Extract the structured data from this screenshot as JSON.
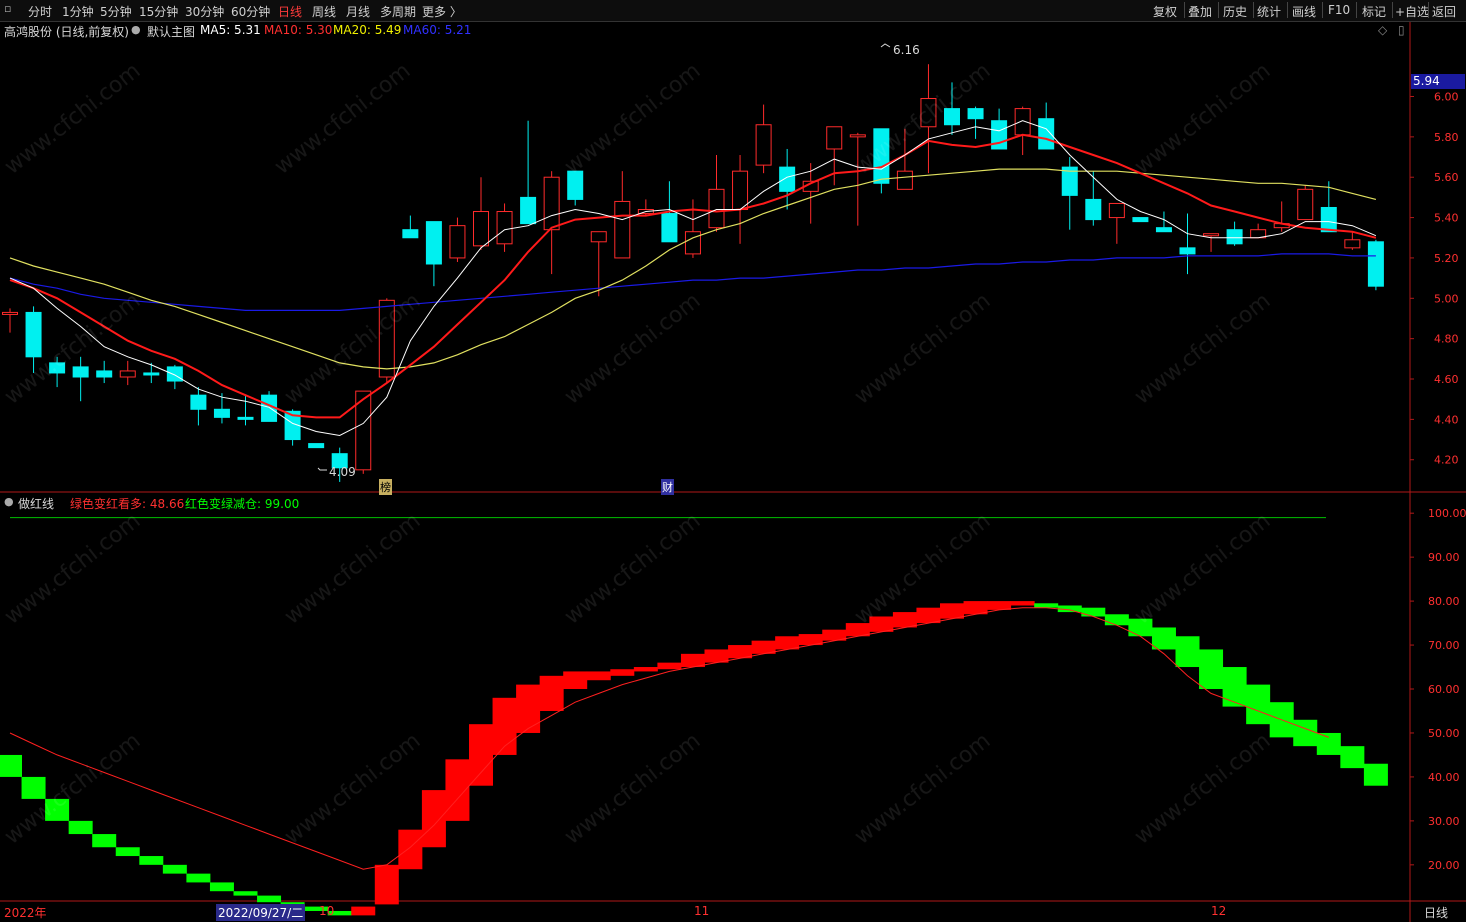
{
  "toolbar": {
    "left_items": [
      "分时",
      "1分钟",
      "5分钟",
      "15分钟",
      "30分钟",
      "60分钟",
      "日线",
      "周线",
      "月线",
      "多周期",
      "更多 〉"
    ],
    "active_item": "日线",
    "right_items": [
      "复权",
      "叠加",
      "历史",
      "统计",
      "画线",
      "F10",
      "标记",
      "+自选",
      "返回"
    ]
  },
  "main_header": {
    "stock": "高鸿股份 (日线,前复权)",
    "chart_name": "默认主图",
    "ma5": "MA5: 5.31",
    "ma10": "MA10: 5.30",
    "ma20": "MA20: 5.49",
    "ma60": "MA60: 5.21"
  },
  "sub_header": {
    "name": "做红线",
    "t1": "绿色变红看多: 48.66",
    "t2": "红色变绿减仓: 99.00"
  },
  "price_tag": "5.94",
  "annotations": {
    "high": "6.16",
    "low": "4.09",
    "mark1": "榜",
    "mark2": "财"
  },
  "xaxis": {
    "year": "2022年",
    "cursor_date": "2022/09/27/二",
    "m10": "10",
    "m11": "11",
    "m12": "12",
    "period": "日线"
  },
  "watermark": "www.cfchi.com",
  "colors": {
    "up": "#ff2b2b",
    "down": "#00f0f0",
    "ma5": "#ffffff",
    "ma10": "#ff1a1a",
    "ma20": "#e0e060",
    "ma60": "#1a1ae6",
    "bull": "#ff0000",
    "bear": "#00ff00"
  },
  "chart_data": [
    {
      "type": "candlestick",
      "title": "高鸿股份 (日线,前复权)",
      "y_ticks": [
        4.2,
        4.4,
        4.6,
        4.8,
        5.0,
        5.2,
        5.4,
        5.6,
        5.8,
        6.0
      ],
      "ylim": [
        4.05,
        6.28
      ],
      "candles": [
        [
          4.92,
          4.95,
          4.83,
          4.93
        ],
        [
          4.93,
          4.96,
          4.63,
          4.71
        ],
        [
          4.68,
          4.71,
          4.56,
          4.63
        ],
        [
          4.66,
          4.71,
          4.49,
          4.61
        ],
        [
          4.64,
          4.69,
          4.58,
          4.61
        ],
        [
          4.61,
          4.69,
          4.57,
          4.64
        ],
        [
          4.63,
          4.68,
          4.58,
          4.62
        ],
        [
          4.66,
          4.67,
          4.55,
          4.59
        ],
        [
          4.52,
          4.56,
          4.37,
          4.45
        ],
        [
          4.45,
          4.53,
          4.38,
          4.41
        ],
        [
          4.41,
          4.52,
          4.37,
          4.4
        ],
        [
          4.52,
          4.54,
          4.39,
          4.39
        ],
        [
          4.44,
          4.45,
          4.27,
          4.3
        ],
        [
          4.28,
          4.28,
          4.26,
          4.26
        ],
        [
          4.23,
          4.26,
          4.09,
          4.16
        ],
        [
          4.15,
          4.54,
          4.13,
          4.54
        ],
        [
          4.61,
          5.0,
          4.58,
          4.99
        ],
        [
          5.34,
          5.41,
          5.3,
          5.3
        ],
        [
          5.38,
          5.38,
          5.06,
          5.17
        ],
        [
          5.2,
          5.4,
          5.18,
          5.36
        ],
        [
          5.26,
          5.6,
          5.24,
          5.43
        ],
        [
          5.27,
          5.47,
          5.23,
          5.43
        ],
        [
          5.5,
          5.88,
          5.43,
          5.37
        ],
        [
          5.34,
          5.63,
          5.12,
          5.6
        ],
        [
          5.63,
          5.6,
          5.46,
          5.49
        ],
        [
          5.28,
          5.33,
          5.01,
          5.33
        ],
        [
          5.2,
          5.63,
          5.2,
          5.48
        ],
        [
          5.42,
          5.49,
          5.41,
          5.44
        ],
        [
          5.42,
          5.58,
          5.32,
          5.28
        ],
        [
          5.22,
          5.49,
          5.2,
          5.33
        ],
        [
          5.35,
          5.71,
          5.33,
          5.54
        ],
        [
          5.44,
          5.71,
          5.27,
          5.63
        ],
        [
          5.66,
          5.96,
          5.62,
          5.86
        ],
        [
          5.65,
          5.74,
          5.44,
          5.53
        ],
        [
          5.53,
          5.67,
          5.37,
          5.58
        ],
        [
          5.74,
          5.77,
          5.56,
          5.85
        ],
        [
          5.8,
          5.82,
          5.36,
          5.81
        ],
        [
          5.84,
          5.82,
          5.52,
          5.57
        ],
        [
          5.54,
          5.84,
          5.57,
          5.63
        ],
        [
          5.85,
          6.16,
          5.62,
          5.99
        ],
        [
          5.94,
          6.07,
          5.81,
          5.86
        ],
        [
          5.94,
          5.95,
          5.79,
          5.89
        ],
        [
          5.88,
          5.94,
          5.74,
          5.74
        ],
        [
          5.81,
          5.95,
          5.71,
          5.94
        ],
        [
          5.89,
          5.97,
          5.78,
          5.74
        ],
        [
          5.65,
          5.7,
          5.34,
          5.51
        ],
        [
          5.49,
          5.63,
          5.36,
          5.39
        ],
        [
          5.4,
          5.47,
          5.27,
          5.47
        ],
        [
          5.4,
          5.4,
          5.38,
          5.38
        ],
        [
          5.35,
          5.43,
          5.33,
          5.33
        ],
        [
          5.25,
          5.42,
          5.12,
          5.22
        ],
        [
          5.31,
          5.32,
          5.23,
          5.32
        ],
        [
          5.34,
          5.38,
          5.26,
          5.27
        ],
        [
          5.3,
          5.37,
          5.3,
          5.34
        ],
        [
          5.35,
          5.48,
          5.33,
          5.37
        ],
        [
          5.39,
          5.56,
          5.41,
          5.54
        ],
        [
          5.45,
          5.58,
          5.35,
          5.33
        ],
        [
          5.25,
          5.33,
          5.24,
          5.29
        ],
        [
          5.28,
          5.29,
          5.04,
          5.06
        ]
      ],
      "ma5": [
        5.1,
        5.05,
        4.95,
        4.86,
        4.76,
        4.71,
        4.67,
        4.62,
        4.55,
        4.51,
        4.49,
        4.46,
        4.38,
        4.34,
        4.32,
        4.38,
        4.51,
        4.79,
        4.96,
        5.1,
        5.25,
        5.34,
        5.36,
        5.41,
        5.44,
        5.42,
        5.39,
        5.43,
        5.44,
        5.39,
        5.44,
        5.44,
        5.53,
        5.6,
        5.63,
        5.69,
        5.65,
        5.64,
        5.71,
        5.79,
        5.82,
        5.85,
        5.83,
        5.88,
        5.84,
        5.71,
        5.6,
        5.49,
        5.43,
        5.39,
        5.32,
        5.3,
        5.3,
        5.3,
        5.32,
        5.38,
        5.38,
        5.36,
        5.31
      ],
      "ma10": [
        5.09,
        5.05,
        5.0,
        4.93,
        4.86,
        4.79,
        4.74,
        4.7,
        4.64,
        4.57,
        4.52,
        4.47,
        4.42,
        4.41,
        4.41,
        4.5,
        4.58,
        4.67,
        4.76,
        4.87,
        4.98,
        5.09,
        5.23,
        5.35,
        5.39,
        5.4,
        5.41,
        5.41,
        5.43,
        5.44,
        5.43,
        5.44,
        5.47,
        5.51,
        5.57,
        5.62,
        5.63,
        5.65,
        5.71,
        5.78,
        5.76,
        5.75,
        5.77,
        5.81,
        5.79,
        5.75,
        5.71,
        5.67,
        5.62,
        5.57,
        5.52,
        5.46,
        5.43,
        5.4,
        5.37,
        5.35,
        5.34,
        5.33,
        5.3
      ],
      "ma20": [
        5.2,
        5.16,
        5.13,
        5.1,
        5.07,
        5.03,
        4.99,
        4.96,
        4.92,
        4.88,
        4.84,
        4.8,
        4.76,
        4.72,
        4.68,
        4.66,
        4.65,
        4.66,
        4.68,
        4.72,
        4.77,
        4.81,
        4.87,
        4.93,
        5.0,
        5.04,
        5.09,
        5.16,
        5.24,
        5.3,
        5.34,
        5.37,
        5.42,
        5.46,
        5.5,
        5.54,
        5.56,
        5.59,
        5.6,
        5.61,
        5.62,
        5.63,
        5.64,
        5.64,
        5.64,
        5.63,
        5.63,
        5.63,
        5.62,
        5.61,
        5.6,
        5.59,
        5.58,
        5.57,
        5.57,
        5.56,
        5.55,
        5.52,
        5.49
      ],
      "ma60": [
        5.1,
        5.07,
        5.05,
        5.02,
        5.0,
        4.99,
        4.98,
        4.97,
        4.96,
        4.95,
        4.94,
        4.94,
        4.94,
        4.94,
        4.94,
        4.95,
        4.96,
        4.97,
        4.98,
        4.99,
        5.0,
        5.01,
        5.02,
        5.03,
        5.04,
        5.05,
        5.06,
        5.07,
        5.08,
        5.09,
        5.09,
        5.1,
        5.1,
        5.11,
        5.12,
        5.13,
        5.14,
        5.14,
        5.15,
        5.15,
        5.16,
        5.17,
        5.17,
        5.18,
        5.18,
        5.19,
        5.19,
        5.2,
        5.2,
        5.2,
        5.21,
        5.21,
        5.21,
        5.21,
        5.22,
        5.22,
        5.22,
        5.21,
        5.21
      ]
    },
    {
      "type": "indicator",
      "title": "做红线",
      "y_ticks": [
        20,
        30,
        40,
        50,
        60,
        70,
        80,
        90,
        100
      ],
      "ylim": [
        12,
        103
      ],
      "ref_line": 99.0,
      "bars": [
        [
          45,
          40,
          "g"
        ],
        [
          40,
          35,
          "g"
        ],
        [
          35,
          30,
          "g"
        ],
        [
          30,
          27,
          "g"
        ],
        [
          27,
          24,
          "g"
        ],
        [
          24,
          22,
          "g"
        ],
        [
          22,
          20,
          "g"
        ],
        [
          20,
          18,
          "g"
        ],
        [
          18,
          16,
          "g"
        ],
        [
          16,
          14,
          "g"
        ],
        [
          14,
          13,
          "g"
        ],
        [
          13,
          11.5,
          "g"
        ],
        [
          11.5,
          10.5,
          "g"
        ],
        [
          10.5,
          9.5,
          "g"
        ],
        [
          9.5,
          8.5,
          "g"
        ],
        [
          8.5,
          10.5,
          "r"
        ],
        [
          11,
          20,
          "r"
        ],
        [
          19,
          28,
          "r"
        ],
        [
          24,
          37,
          "r"
        ],
        [
          30,
          44,
          "r"
        ],
        [
          38,
          52,
          "r"
        ],
        [
          45,
          58,
          "r"
        ],
        [
          50,
          61,
          "r"
        ],
        [
          55,
          63,
          "r"
        ],
        [
          60,
          64,
          "r"
        ],
        [
          62,
          64,
          "r"
        ],
        [
          63,
          64.5,
          "r"
        ],
        [
          64,
          65,
          "r"
        ],
        [
          64.5,
          66,
          "r"
        ],
        [
          65,
          68,
          "r"
        ],
        [
          66,
          69,
          "r"
        ],
        [
          67,
          70,
          "r"
        ],
        [
          68,
          71,
          "r"
        ],
        [
          69,
          72,
          "r"
        ],
        [
          70,
          72.5,
          "r"
        ],
        [
          71,
          73.5,
          "r"
        ],
        [
          72,
          75,
          "r"
        ],
        [
          73,
          76.5,
          "r"
        ],
        [
          74,
          77.5,
          "r"
        ],
        [
          75,
          78.5,
          "r"
        ],
        [
          76,
          79.5,
          "r"
        ],
        [
          77,
          80,
          "r"
        ],
        [
          78,
          80,
          "r"
        ],
        [
          79,
          80,
          "r"
        ],
        [
          79.5,
          78.5,
          "g"
        ],
        [
          79,
          77.5,
          "g"
        ],
        [
          78.5,
          76.5,
          "g"
        ],
        [
          77,
          74.5,
          "g"
        ],
        [
          76,
          72,
          "g"
        ],
        [
          74,
          69,
          "g"
        ],
        [
          72,
          65,
          "g"
        ],
        [
          69,
          60,
          "g"
        ],
        [
          65,
          56,
          "g"
        ],
        [
          61,
          52,
          "g"
        ],
        [
          57,
          49,
          "g"
        ],
        [
          53,
          47,
          "g"
        ],
        [
          50,
          45,
          "g"
        ],
        [
          47,
          42,
          "g"
        ],
        [
          43,
          38,
          "g"
        ]
      ],
      "line": [
        50,
        47.5,
        45,
        43,
        41,
        39,
        37,
        35,
        33,
        31,
        29,
        27,
        25,
        23,
        21,
        19,
        20,
        24,
        29,
        35,
        41,
        47,
        51,
        54,
        57,
        59,
        61,
        62.5,
        64,
        65,
        66,
        67,
        68,
        69,
        70,
        71,
        72,
        73,
        74,
        75,
        76,
        77,
        78,
        78.5,
        78.5,
        78,
        76.5,
        74.5,
        72,
        68,
        63,
        59,
        57,
        55,
        53,
        51,
        49
      ]
    }
  ]
}
